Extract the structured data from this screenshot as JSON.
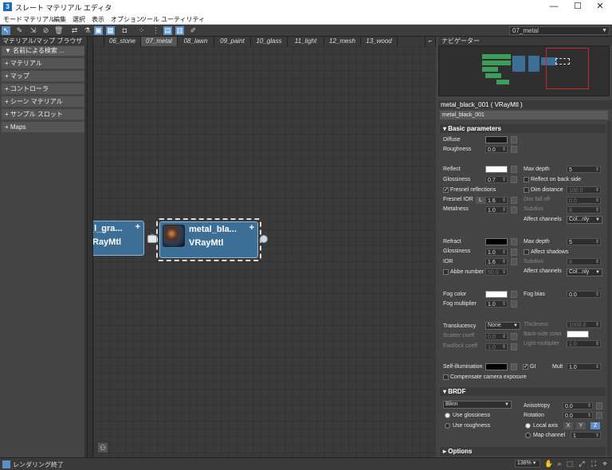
{
  "window": {
    "title": "スレート マテリアル エディタ",
    "app_icon_label": "3",
    "minimize_label": "—",
    "maximize_label": "☐",
    "close_label": "✕"
  },
  "menu": [
    "モード",
    "マテリアル",
    "編集",
    "選択",
    "表示",
    "オプション",
    "ツール",
    "ユーティリティ"
  ],
  "view_selector": {
    "value": "07_metal"
  },
  "browser": {
    "title": "マテリアル/マップ ブラウザ",
    "search_placeholder": "名前による検索 ...",
    "categories": [
      "+ マテリアル",
      "+ マップ",
      "+ コントローラ",
      "+ シーン マテリアル",
      "+ サンプル スロット",
      "+ Maps"
    ]
  },
  "tabs": [
    "06_stone",
    "07_metal",
    "08_lawn",
    "09_paint",
    "10_glass",
    "11_light",
    "12_mesh",
    "13_wood"
  ],
  "active_tab": "07_metal",
  "nodes": {
    "left": {
      "title": "_l_gra...",
      "subtitle": "RayMtl"
    },
    "selected": {
      "title": "metal_bla...",
      "subtitle": "VRayMtl"
    }
  },
  "navigator": {
    "title": "ナビゲーター"
  },
  "properties": {
    "header": "metal_black_001  ( VRayMtl )",
    "name": "metal_black_001",
    "basic": {
      "title": "Basic parameters",
      "diffuse": "Diffuse",
      "roughness": "Roughness",
      "roughness_val": "0.0",
      "reflect": "Reflect",
      "glossiness": "Glossiness",
      "glossiness_val": "0.7",
      "fresnel": "Fresnel reflections",
      "fresnel_ior": "Fresnel IOR",
      "fresnel_ior_lock": "L",
      "fresnel_ior_val": "1.6",
      "metalness": "Metalness",
      "metalness_val": "1.0",
      "max_depth": "Max depth",
      "max_depth_val": "5",
      "reflect_back": "Reflect on back side",
      "dim_distance": "Dim distance",
      "dim_distance_val": "100.0",
      "dim_falloff": "Dim fall off",
      "dim_falloff_val": "0.0",
      "subdivs": "Subdivs",
      "subdivs_val": "8",
      "affect_channels": "Affect channels",
      "affect_channels_val": "Col...nly",
      "refract": "Refract",
      "r_glossiness": "Glossiness",
      "r_glossiness_val": "1.0",
      "ior": "IOR",
      "ior_val": "1.6",
      "abbe": "Abbe number",
      "abbe_val": "50.0",
      "r_max_depth": "Max depth",
      "r_max_depth_val": "5",
      "affect_shadows": "Affect shadows",
      "r_subdivs": "Subdivs",
      "r_subdivs_val": "8",
      "r_affect_channels": "Affect channels",
      "r_affect_channels_val": "Col...nly",
      "fog_color": "Fog color",
      "fog_bias": "Fog bias",
      "fog_bias_val": "0.0",
      "fog_multiplier": "Fog multiplier",
      "fog_multiplier_val": "1.0",
      "translucency": "Translucency",
      "translucency_val": "None",
      "thickness": "Thickness",
      "thickness_val": "1000.0",
      "scatter": "Scatter coeff",
      "scatter_val": "0.0",
      "backside": "Back-side color",
      "fwd_bck": "Fwd/bck coeff",
      "fwd_bck_val": "1.0",
      "light_mult": "Light multiplier",
      "light_mult_val": "1.0",
      "self_illum": "Self-illumination",
      "gi": "GI",
      "mult": "Mult",
      "mult_val": "1.0",
      "compensate": "Compensate camera exposure"
    },
    "brdf": {
      "title": "BRDF",
      "type": "Blinn",
      "use_glossiness": "Use glossiness",
      "use_roughness": "Use roughness",
      "anisotropy": "Anisotropy",
      "anisotropy_val": "0.0",
      "rotation": "Rotation",
      "rotation_val": "0.0",
      "local_axis": "Local axis",
      "axes": [
        "X",
        "Y",
        "Z"
      ],
      "map_channel": "Map channel",
      "map_channel_val": "1"
    },
    "options": {
      "title": "Options"
    }
  },
  "status": {
    "message": "レンダリング終了",
    "zoom": "138%"
  },
  "colors": {
    "diffuse": "#1a1a1a",
    "reflect": "#ffffff",
    "refract": "#000000",
    "fog": "#ffffff",
    "backside": "#ffffff",
    "self_illum": "#000000",
    "node": "#3c6e96",
    "accent": "#5b8fc7"
  }
}
